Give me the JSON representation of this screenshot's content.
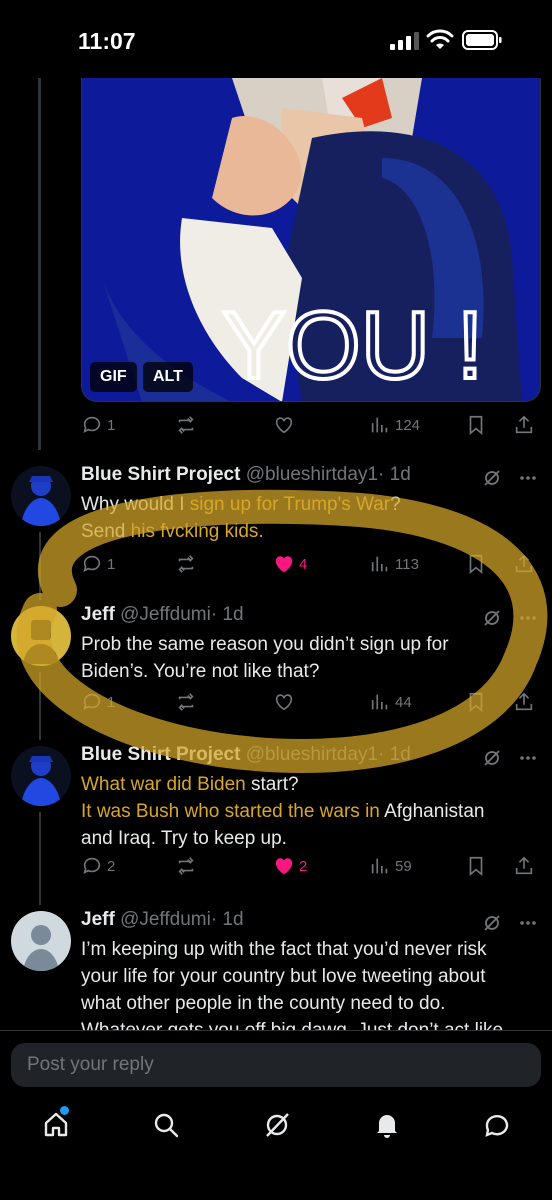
{
  "status_bar": {
    "time": "11:07"
  },
  "media": {
    "gif_badge": "GIF",
    "alt_badge": "ALT",
    "caption_art": "YOU !"
  },
  "post_actions": {
    "replies": "1",
    "reposts": "",
    "likes": "",
    "views": "124"
  },
  "replies": [
    {
      "name": "Blue Shirt Project",
      "handle": "@blueshirtday1",
      "time": "· 1d",
      "segments": [
        {
          "text": "Why would I ",
          "highlight": false
        },
        {
          "text": "sign up for Trump's War",
          "highlight": true
        },
        {
          "text": "?",
          "highlight": false
        },
        {
          "text": "\n",
          "highlight": false
        },
        {
          "text": "Send ",
          "highlight": false
        },
        {
          "text": "his fvcking kids.",
          "highlight": true
        }
      ],
      "replies_count": "1",
      "likes": "4",
      "liked": true,
      "views": "113"
    },
    {
      "name": "Jeff",
      "handle": "@Jeffdumi",
      "time": "· 1d",
      "segments": [
        {
          "text": "Prob the same reason you didn’t sign up for Biden’s. You’re not like that?",
          "highlight": false
        }
      ],
      "replies_count": "1",
      "likes": "",
      "liked": false,
      "views": "44"
    },
    {
      "name": "Blue Shirt Project",
      "handle": "@blueshirtday1",
      "time": "· 1d",
      "segments": [
        {
          "text": "What war did Biden ",
          "highlight": true
        },
        {
          "text": "start?",
          "highlight": false
        },
        {
          "text": "\n",
          "highlight": false
        },
        {
          "text": "It was Bush who started the wars in ",
          "highlight": true
        },
        {
          "text": "Afghanistan and Iraq. Try to keep up.",
          "highlight": false
        }
      ],
      "replies_count": "2",
      "likes": "2",
      "liked": true,
      "views": "59"
    },
    {
      "name": "Jeff",
      "handle": "@Jeffdumi",
      "time": "· 1d",
      "segments": [
        {
          "text": "I’m keeping up with the fact that you’d never risk your life for your country but love tweeting about what other people in the county need to do. Whatever gets you off big dawg. Just don’t act like",
          "highlight": false
        }
      ],
      "replies_count": "",
      "likes": "",
      "liked": false,
      "views": ""
    }
  ],
  "reply_bar": {
    "placeholder": "Post your reply"
  },
  "colors": {
    "background": "#000000",
    "text": "#e7e9ea",
    "muted": "#71767b",
    "like": "#f91880",
    "highlight": "#d9a62b",
    "accent": "#1d9bf0"
  },
  "tabs": [
    "home-icon",
    "search-icon",
    "grok-icon",
    "notifications-icon",
    "messages-icon"
  ]
}
